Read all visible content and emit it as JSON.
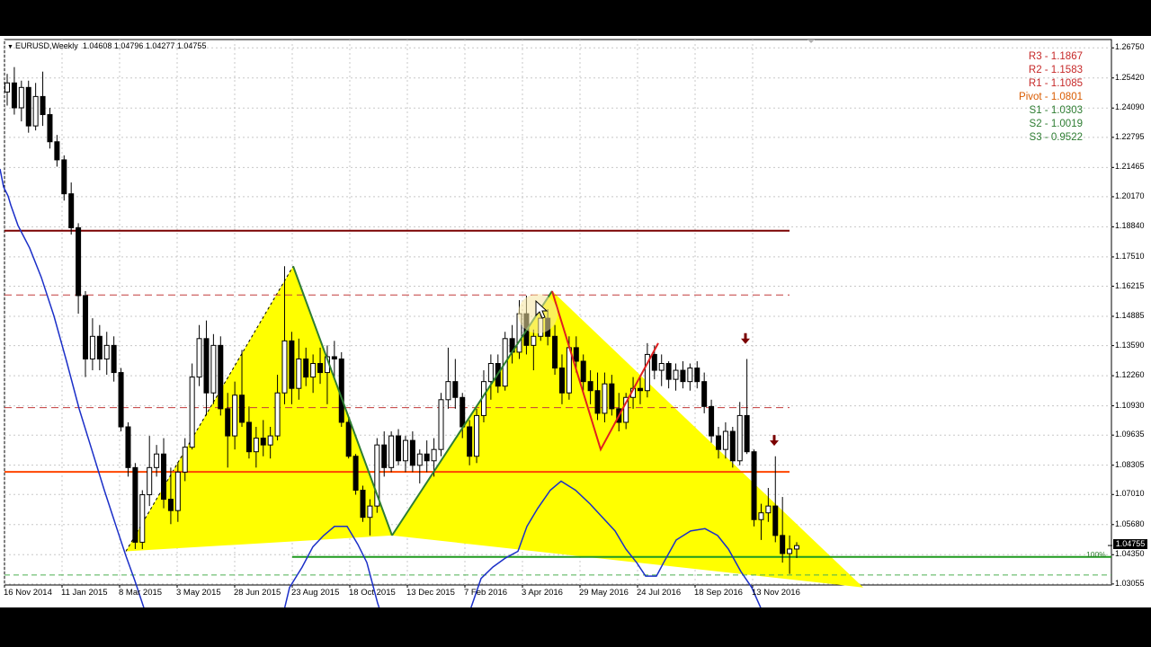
{
  "header": {
    "symbol_timeframe": "EURUSD,Weekly",
    "ohlc": "1.04608 1.04796 1.04277 1.04755"
  },
  "pivot_levels": [
    {
      "label": "R3 - 1.1867",
      "color": "#c62828"
    },
    {
      "label": "R2 - 1.1583",
      "color": "#c62828"
    },
    {
      "label": "R1 - 1.1085",
      "color": "#c62828"
    },
    {
      "label": "Pivot - 1.0801",
      "color": "#d95b00"
    },
    {
      "label": "S1 - 1.0303",
      "color": "#2e7d32"
    },
    {
      "label": "S2 - 1.0019",
      "color": "#2e7d32"
    },
    {
      "label": "S3 - 0.9522",
      "color": "#2e7d32"
    }
  ],
  "current_price_label": "1.04755",
  "fib_label": "100%",
  "colors": {
    "bull_candle": "#ffffff",
    "bear_candle": "#000000",
    "grid": "#c8c8c8",
    "oscillator": "#1b2fc8",
    "pattern_fill": "#ffff00",
    "green_leg": "#2e7d32",
    "red_leg": "#e02020",
    "resistance_dark": "#7a0000",
    "pivot_line": "#ff4500",
    "support_line": "#1f9a1f",
    "arrow": "#7a0000"
  },
  "chart_data": {
    "type": "candlestick",
    "symbol": "EURUSD",
    "timeframe": "Weekly",
    "ylim": [
      1.0305,
      1.268
    ],
    "y_ticks": [
      "1.26750",
      "1.25420",
      "1.24090",
      "1.22795",
      "1.21465",
      "1.20170",
      "1.18840",
      "1.17510",
      "1.16215",
      "1.14885",
      "1.13590",
      "1.12260",
      "1.10930",
      "1.09635",
      "1.08305",
      "1.07010",
      "1.05680",
      "1.04350",
      "1.03055"
    ],
    "x_ticks": [
      "16 Nov 2014",
      "11 Jan 2015",
      "8 Mar 2015",
      "3 May 2015",
      "28 Jun 2015",
      "23 Aug 2015",
      "18 Oct 2015",
      "13 Dec 2015",
      "7 Feb 2016",
      "3 Apr 2016",
      "29 May 2016",
      "24 Jul 2016",
      "18 Sep 2016",
      "13 Nov 2016"
    ],
    "grid": true,
    "horizontal_levels": [
      {
        "price": 1.1867,
        "style": "solid",
        "name": "R3"
      },
      {
        "price": 1.1583,
        "style": "dashed",
        "name": "R2"
      },
      {
        "price": 1.1085,
        "style": "dashed",
        "name": "R1"
      },
      {
        "price": 1.0801,
        "style": "solid",
        "name": "Pivot"
      },
      {
        "price": 1.0425,
        "style": "solid",
        "name": "100%"
      }
    ],
    "candles": [
      [
        1.248,
        1.256,
        1.242,
        1.252
      ],
      [
        1.252,
        1.259,
        1.238,
        1.241
      ],
      [
        1.241,
        1.253,
        1.235,
        1.25
      ],
      [
        1.25,
        1.253,
        1.23,
        1.233
      ],
      [
        1.233,
        1.252,
        1.231,
        1.246
      ],
      [
        1.246,
        1.257,
        1.233,
        1.238
      ],
      [
        1.238,
        1.241,
        1.223,
        1.226
      ],
      [
        1.226,
        1.229,
        1.215,
        1.218
      ],
      [
        1.218,
        1.22,
        1.2,
        1.203
      ],
      [
        1.203,
        1.208,
        1.185,
        1.188
      ],
      [
        1.188,
        1.19,
        1.15,
        1.158
      ],
      [
        1.158,
        1.16,
        1.122,
        1.13
      ],
      [
        1.13,
        1.148,
        1.125,
        1.14
      ],
      [
        1.14,
        1.145,
        1.125,
        1.13
      ],
      [
        1.13,
        1.142,
        1.123,
        1.136
      ],
      [
        1.136,
        1.14,
        1.12,
        1.124
      ],
      [
        1.124,
        1.126,
        1.098,
        1.1
      ],
      [
        1.1,
        1.102,
        1.078,
        1.082
      ],
      [
        1.082,
        1.084,
        1.046,
        1.049
      ],
      [
        1.049,
        1.072,
        1.046,
        1.07
      ],
      [
        1.07,
        1.096,
        1.065,
        1.082
      ],
      [
        1.082,
        1.092,
        1.078,
        1.088
      ],
      [
        1.088,
        1.095,
        1.064,
        1.068
      ],
      [
        1.068,
        1.082,
        1.057,
        1.063
      ],
      [
        1.063,
        1.084,
        1.058,
        1.08
      ],
      [
        1.08,
        1.095,
        1.076,
        1.091
      ],
      [
        1.091,
        1.128,
        1.09,
        1.122
      ],
      [
        1.122,
        1.145,
        1.118,
        1.139
      ],
      [
        1.139,
        1.147,
        1.105,
        1.115
      ],
      [
        1.115,
        1.141,
        1.11,
        1.136
      ],
      [
        1.136,
        1.14,
        1.105,
        1.108
      ],
      [
        1.108,
        1.115,
        1.082,
        1.096
      ],
      [
        1.096,
        1.12,
        1.09,
        1.114
      ],
      [
        1.114,
        1.134,
        1.1,
        1.102
      ],
      [
        1.102,
        1.109,
        1.086,
        1.089
      ],
      [
        1.089,
        1.1,
        1.082,
        1.095
      ],
      [
        1.095,
        1.103,
        1.087,
        1.092
      ],
      [
        1.092,
        1.1,
        1.086,
        1.096
      ],
      [
        1.096,
        1.123,
        1.094,
        1.115
      ],
      [
        1.115,
        1.171,
        1.11,
        1.138
      ],
      [
        1.138,
        1.142,
        1.11,
        1.117
      ],
      [
        1.117,
        1.139,
        1.112,
        1.13
      ],
      [
        1.13,
        1.135,
        1.118,
        1.122
      ],
      [
        1.122,
        1.132,
        1.115,
        1.128
      ],
      [
        1.128,
        1.135,
        1.119,
        1.124
      ],
      [
        1.124,
        1.136,
        1.11,
        1.131
      ],
      [
        1.131,
        1.138,
        1.121,
        1.13
      ],
      [
        1.13,
        1.133,
        1.1,
        1.102
      ],
      [
        1.102,
        1.104,
        1.086,
        1.087
      ],
      [
        1.087,
        1.088,
        1.07,
        1.072
      ],
      [
        1.072,
        1.074,
        1.058,
        1.06
      ],
      [
        1.06,
        1.068,
        1.052,
        1.065
      ],
      [
        1.065,
        1.095,
        1.062,
        1.092
      ],
      [
        1.092,
        1.098,
        1.078,
        1.082
      ],
      [
        1.082,
        1.098,
        1.08,
        1.096
      ],
      [
        1.096,
        1.099,
        1.083,
        1.085
      ],
      [
        1.085,
        1.096,
        1.08,
        1.094
      ],
      [
        1.094,
        1.098,
        1.08,
        1.083
      ],
      [
        1.083,
        1.09,
        1.075,
        1.088
      ],
      [
        1.088,
        1.094,
        1.08,
        1.085
      ],
      [
        1.085,
        1.095,
        1.078,
        1.09
      ],
      [
        1.09,
        1.115,
        1.087,
        1.112
      ],
      [
        1.112,
        1.135,
        1.108,
        1.12
      ],
      [
        1.12,
        1.13,
        1.108,
        1.113
      ],
      [
        1.113,
        1.115,
        1.095,
        1.1
      ],
      [
        1.1,
        1.103,
        1.083,
        1.087
      ],
      [
        1.087,
        1.108,
        1.084,
        1.105
      ],
      [
        1.105,
        1.125,
        1.102,
        1.12
      ],
      [
        1.12,
        1.132,
        1.112,
        1.128
      ],
      [
        1.128,
        1.132,
        1.115,
        1.118
      ],
      [
        1.118,
        1.142,
        1.116,
        1.139
      ],
      [
        1.139,
        1.145,
        1.128,
        1.133
      ],
      [
        1.133,
        1.156,
        1.13,
        1.15
      ],
      [
        1.15,
        1.158,
        1.132,
        1.136
      ],
      [
        1.136,
        1.143,
        1.125,
        1.14
      ],
      [
        1.14,
        1.152,
        1.138,
        1.148
      ],
      [
        1.148,
        1.152,
        1.136,
        1.14
      ],
      [
        1.14,
        1.145,
        1.123,
        1.126
      ],
      [
        1.126,
        1.132,
        1.11,
        1.115
      ],
      [
        1.115,
        1.14,
        1.112,
        1.135
      ],
      [
        1.135,
        1.14,
        1.124,
        1.129
      ],
      [
        1.129,
        1.132,
        1.116,
        1.12
      ],
      [
        1.12,
        1.125,
        1.11,
        1.116
      ],
      [
        1.116,
        1.124,
        1.103,
        1.106
      ],
      [
        1.106,
        1.124,
        1.102,
        1.119
      ],
      [
        1.119,
        1.123,
        1.105,
        1.108
      ],
      [
        1.108,
        1.115,
        1.098,
        1.102
      ],
      [
        1.102,
        1.115,
        1.099,
        1.113
      ],
      [
        1.113,
        1.122,
        1.108,
        1.117
      ],
      [
        1.117,
        1.122,
        1.11,
        1.116
      ],
      [
        1.116,
        1.137,
        1.113,
        1.132
      ],
      [
        1.132,
        1.136,
        1.121,
        1.125
      ],
      [
        1.125,
        1.132,
        1.118,
        1.128
      ],
      [
        1.128,
        1.129,
        1.117,
        1.121
      ],
      [
        1.121,
        1.128,
        1.116,
        1.125
      ],
      [
        1.125,
        1.129,
        1.117,
        1.12
      ],
      [
        1.12,
        1.128,
        1.116,
        1.126
      ],
      [
        1.126,
        1.129,
        1.117,
        1.12
      ],
      [
        1.12,
        1.124,
        1.106,
        1.109
      ],
      [
        1.109,
        1.112,
        1.093,
        1.096
      ],
      [
        1.096,
        1.1,
        1.086,
        1.09
      ],
      [
        1.09,
        1.102,
        1.086,
        1.098
      ],
      [
        1.098,
        1.1,
        1.082,
        1.085
      ],
      [
        1.085,
        1.111,
        1.083,
        1.105
      ],
      [
        1.105,
        1.13,
        1.088,
        1.089
      ],
      [
        1.089,
        1.09,
        1.056,
        1.059
      ],
      [
        1.059,
        1.066,
        1.05,
        1.062
      ],
      [
        1.062,
        1.073,
        1.058,
        1.065
      ],
      [
        1.065,
        1.087,
        1.049,
        1.052
      ],
      [
        1.052,
        1.069,
        1.04,
        1.044
      ],
      [
        1.044,
        1.052,
        1.035,
        1.046
      ],
      [
        1.046,
        1.049,
        1.042,
        1.0475
      ]
    ],
    "oscillator": [
      [
        0,
        1.214
      ],
      [
        4,
        1.206
      ],
      [
        9,
        1.202
      ],
      [
        12,
        1.198
      ],
      [
        20,
        1.189
      ],
      [
        33,
        1.179
      ],
      [
        46,
        1.166
      ],
      [
        60,
        1.149
      ],
      [
        74,
        1.129
      ],
      [
        88,
        1.108
      ],
      [
        102,
        1.09
      ],
      [
        116,
        1.072
      ],
      [
        130,
        1.055
      ],
      [
        140,
        1.043
      ],
      [
        150,
        1.032
      ],
      [
        160,
        1.02
      ],
      [
        175,
        1.01
      ],
      [
        200,
        1.0
      ],
      [
        215,
        1.0
      ],
      [
        228,
        1.01
      ],
      [
        244,
        1.009
      ],
      [
        258,
        1.008
      ],
      [
        272,
        1.01
      ],
      [
        285,
        1.005
      ],
      [
        298,
        1.002
      ],
      [
        310,
        1.009
      ],
      [
        322,
        1.029
      ],
      [
        336,
        1.038
      ],
      [
        348,
        1.047
      ],
      [
        360,
        1.052
      ],
      [
        372,
        1.056
      ],
      [
        386,
        1.056
      ],
      [
        398,
        1.048
      ],
      [
        408,
        1.04
      ],
      [
        420,
        1.022
      ],
      [
        432,
        1.008
      ],
      [
        445,
        1.0
      ],
      [
        470,
        1.0
      ],
      [
        500,
        1.0
      ],
      [
        522,
        1.018
      ],
      [
        535,
        1.033
      ],
      [
        548,
        1.038
      ],
      [
        562,
        1.042
      ],
      [
        576,
        1.045
      ],
      [
        586,
        1.056
      ],
      [
        598,
        1.064
      ],
      [
        612,
        1.072
      ],
      [
        624,
        1.076
      ],
      [
        640,
        1.072
      ],
      [
        656,
        1.066
      ],
      [
        670,
        1.06
      ],
      [
        684,
        1.054
      ],
      [
        696,
        1.046
      ],
      [
        708,
        1.04
      ],
      [
        718,
        1.034
      ],
      [
        730,
        1.034
      ],
      [
        738,
        1.04
      ],
      [
        752,
        1.05
      ],
      [
        768,
        1.054
      ],
      [
        784,
        1.055
      ],
      [
        798,
        1.052
      ],
      [
        810,
        1.046
      ],
      [
        824,
        1.036
      ],
      [
        836,
        1.029
      ],
      [
        846,
        1.02
      ],
      [
        860,
        1.01
      ]
    ],
    "drawings": {
      "left_triangle": [
        [
          140,
          1.045
        ],
        [
          326,
          1.171
        ],
        [
          436,
          1.052
        ]
      ],
      "right_triangle": [
        [
          436,
          1.052
        ],
        [
          614,
          1.16
        ],
        [
          960,
          1.029
        ]
      ],
      "green_leg_1": [
        [
          326,
          1.171
        ],
        [
          436,
          1.052
        ]
      ],
      "green_leg_2": [
        [
          436,
          1.052
        ],
        [
          614,
          1.16
        ]
      ],
      "red_zigzag": [
        [
          614,
          1.16
        ],
        [
          668,
          1.09
        ],
        [
          732,
          1.137
        ]
      ],
      "arrows": [
        [
          829,
          1.139
        ],
        [
          861,
          1.094
        ]
      ]
    }
  }
}
